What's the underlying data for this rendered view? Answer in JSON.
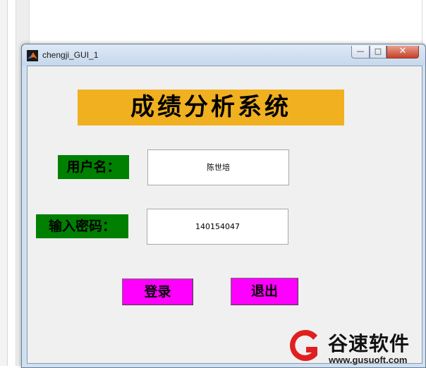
{
  "window": {
    "title": "chengji_GUI_1",
    "controls": {
      "minimize": "—",
      "maximize": "□",
      "close": "✕"
    }
  },
  "form": {
    "heading": "成绩分析系统",
    "username_label": "用户名：",
    "username_value": "陈世培",
    "password_label": "输入密码：",
    "password_value": "140154047",
    "login_button": "登录",
    "exit_button": "退出"
  },
  "watermark": {
    "name": "谷速软件",
    "url": "www.gusuoft.com"
  },
  "colors": {
    "heading_bg": "#f0b020",
    "label_bg": "#008000",
    "button_bg": "#ff00ff",
    "window_bg": "#f0f0f0",
    "watermark_red": "#e02020"
  },
  "icons": {
    "app": "matlab-icon",
    "logo": "gusu-logo-icon"
  }
}
